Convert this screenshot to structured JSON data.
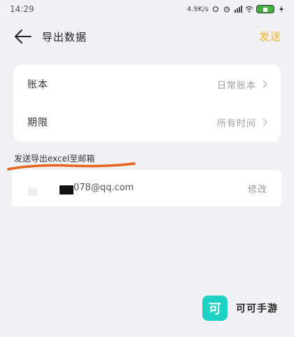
{
  "status_bar": {
    "time": "14:29",
    "net_speed": "4.9K/s",
    "battery_icon": "battery-icon"
  },
  "header": {
    "title": "导出数据",
    "send_label": "发送",
    "accent_color": "#f0b416"
  },
  "settings": {
    "rows": [
      {
        "label": "账本",
        "value": "日常账本"
      },
      {
        "label": "期限",
        "value": "所有时间"
      }
    ]
  },
  "export": {
    "section_label": "发送导出excel至邮箱",
    "email": "078@qq.com",
    "edit_label": "修改",
    "scribble_color": "#e8631e"
  },
  "watermark": {
    "logo_char": "可",
    "text": "可可手游"
  }
}
